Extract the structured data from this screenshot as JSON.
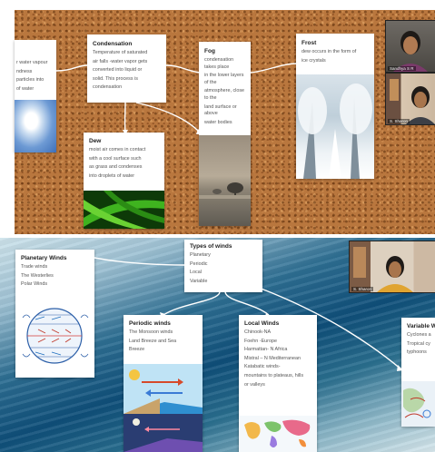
{
  "board1": {
    "water_card": {
      "lines": [
        "r water vapour",
        "ndness",
        "particles into",
        "of water"
      ]
    },
    "condensation": {
      "title": "Condensation",
      "lines": [
        "Temperature of saturated",
        "air falls -water vapor gets",
        "converted into liquid or",
        "solid. This process is",
        "condensation"
      ]
    },
    "fog": {
      "title": "Fog",
      "lines": [
        "condensation takes place",
        "in the lower layers of the",
        "atmosphere, close to the",
        "land surface or above",
        "water bodies"
      ]
    },
    "frost": {
      "title": "Frost",
      "lines": [
        "dew occurs in the form of",
        "ice crystals"
      ]
    },
    "dew": {
      "title": "Dew",
      "lines": [
        "moist air comes in contact",
        "with a cool surface such",
        "as grass and condenses",
        "into droplets of water"
      ]
    },
    "participants": [
      {
        "name": "Sandhya S R"
      },
      {
        "name": "S. Sharon"
      }
    ]
  },
  "board2": {
    "types": {
      "title": "Types of winds",
      "lines": [
        "Planetary",
        "Periodic",
        "Local",
        "Variable"
      ]
    },
    "planetary": {
      "title": "Planetary Winds",
      "lines": [
        "Trade winds",
        "The Westerlies",
        "Polar Winds"
      ]
    },
    "periodic": {
      "title": "Periodic winds",
      "lines": [
        "The Monsoon winds",
        "Land Breeze and Sea",
        "Breeze"
      ]
    },
    "local": {
      "title": "Local Winds",
      "lines": [
        "Chinook-NA",
        "Foehn -Europe",
        "Harmattan- N Africa",
        "Mistral – N Mediterranean",
        "Katabatic winds-",
        "mountains to plateaus, hills",
        "or valleys"
      ]
    },
    "variable": {
      "title": "Variable W",
      "lines": [
        "Cyclones a",
        "Tropical cy",
        "typhoons"
      ]
    },
    "participant": {
      "name": "S. Sharon"
    }
  },
  "colors": {
    "cork": "#b9773e",
    "card": "#ffffff",
    "ocean": "#0f4f7a"
  }
}
